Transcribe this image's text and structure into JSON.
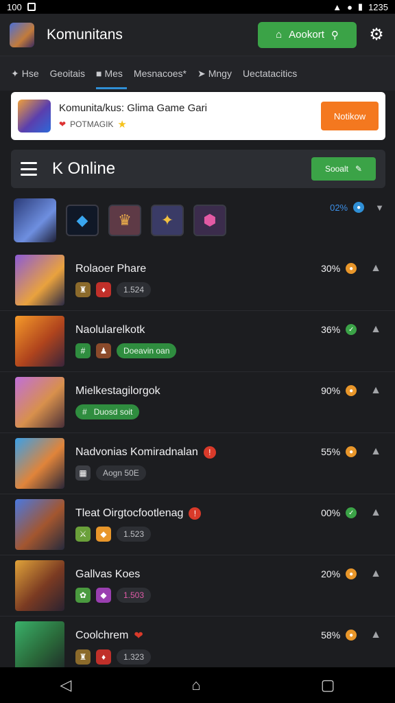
{
  "status": {
    "left_text": "100",
    "right_text": "1235"
  },
  "app": {
    "title": "Komunitans",
    "account_label": "Aookort"
  },
  "tabs": [
    {
      "label": "Hse",
      "icon": "star-icon"
    },
    {
      "label": "Geoitais",
      "icon": ""
    },
    {
      "label": "Mes",
      "icon": "gift-icon"
    },
    {
      "label": "Mesnacoes*",
      "icon": ""
    },
    {
      "label": "Mngy",
      "icon": "pin-icon"
    },
    {
      "label": "Uectatacitics",
      "icon": ""
    }
  ],
  "banner": {
    "title": "Komunita/kus: Glima Game Gari",
    "sub": "POTMAGIK",
    "button": "Notikow"
  },
  "section": {
    "title": "K Online",
    "button": "Sooalt"
  },
  "featured": {
    "meta": "02%"
  },
  "rows": [
    {
      "title": "Rolaoer Phare",
      "pct": "30%",
      "status": "orange",
      "tag1": "",
      "tag2": "",
      "pill": "1.524",
      "pill_green": false,
      "alert": false
    },
    {
      "title": "Naolularelkotk",
      "pct": "36%",
      "status": "green",
      "tag1": "",
      "tag2": "",
      "pill": "Doeavin oan",
      "pill_green": true,
      "alert": false
    },
    {
      "title": "Mielkestagilorgok",
      "pct": "90%",
      "status": "orange",
      "tag1": "",
      "tag2": "",
      "pill": "Duosd soit",
      "pill_green": true,
      "alert": false
    },
    {
      "title": "Nadvonias Komiradnalan",
      "pct": "55%",
      "status": "orange",
      "tag1": "",
      "tag2": "",
      "pill": "Aogn 50E",
      "pill_green": false,
      "alert": true
    },
    {
      "title": "Tleat Oirgtocfootlenag",
      "pct": "00%",
      "status": "green",
      "tag1": "",
      "tag2": "",
      "pill": "1.523",
      "pill_green": false,
      "alert": true
    },
    {
      "title": "Gallvas Koes",
      "pct": "20%",
      "status": "orange",
      "tag1": "",
      "tag2": "",
      "pill": "1.503",
      "pill_green": false,
      "alert": false
    },
    {
      "title": "Coolchrem",
      "pct": "58%",
      "status": "orange",
      "tag1": "",
      "tag2": "",
      "pill": "1.323",
      "pill_green": false,
      "alert": false
    }
  ],
  "colors": {
    "accent_green": "#3ba347",
    "accent_orange": "#f4781f",
    "accent_blue": "#2f8fd6",
    "background": "#1c1d20"
  }
}
